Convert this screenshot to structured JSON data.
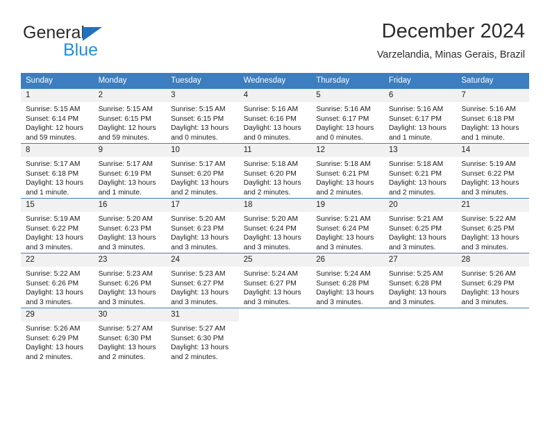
{
  "brand": {
    "name_part1": "General",
    "name_part2": "Blue",
    "flag_icon": "triangle-flag-icon"
  },
  "header": {
    "title": "December 2024",
    "subtitle": "Varzelandia, Minas Gerais, Brazil"
  },
  "colors": {
    "header_blue": "#3c7ebf",
    "brand_blue": "#1f8fdd",
    "flag_blue": "#1f72bc",
    "daynum_band": "#f1f1f1",
    "text": "#1c1c1c"
  },
  "calendar": {
    "weekday_headers": [
      "Sunday",
      "Monday",
      "Tuesday",
      "Wednesday",
      "Thursday",
      "Friday",
      "Saturday"
    ],
    "weeks": [
      [
        {
          "day": "1",
          "sunrise": "Sunrise: 5:15 AM",
          "sunset": "Sunset: 6:14 PM",
          "daylight_line1": "Daylight: 12 hours",
          "daylight_line2": "and 59 minutes."
        },
        {
          "day": "2",
          "sunrise": "Sunrise: 5:15 AM",
          "sunset": "Sunset: 6:15 PM",
          "daylight_line1": "Daylight: 12 hours",
          "daylight_line2": "and 59 minutes."
        },
        {
          "day": "3",
          "sunrise": "Sunrise: 5:15 AM",
          "sunset": "Sunset: 6:15 PM",
          "daylight_line1": "Daylight: 13 hours",
          "daylight_line2": "and 0 minutes."
        },
        {
          "day": "4",
          "sunrise": "Sunrise: 5:16 AM",
          "sunset": "Sunset: 6:16 PM",
          "daylight_line1": "Daylight: 13 hours",
          "daylight_line2": "and 0 minutes."
        },
        {
          "day": "5",
          "sunrise": "Sunrise: 5:16 AM",
          "sunset": "Sunset: 6:17 PM",
          "daylight_line1": "Daylight: 13 hours",
          "daylight_line2": "and 0 minutes."
        },
        {
          "day": "6",
          "sunrise": "Sunrise: 5:16 AM",
          "sunset": "Sunset: 6:17 PM",
          "daylight_line1": "Daylight: 13 hours",
          "daylight_line2": "and 1 minute."
        },
        {
          "day": "7",
          "sunrise": "Sunrise: 5:16 AM",
          "sunset": "Sunset: 6:18 PM",
          "daylight_line1": "Daylight: 13 hours",
          "daylight_line2": "and 1 minute."
        }
      ],
      [
        {
          "day": "8",
          "sunrise": "Sunrise: 5:17 AM",
          "sunset": "Sunset: 6:18 PM",
          "daylight_line1": "Daylight: 13 hours",
          "daylight_line2": "and 1 minute."
        },
        {
          "day": "9",
          "sunrise": "Sunrise: 5:17 AM",
          "sunset": "Sunset: 6:19 PM",
          "daylight_line1": "Daylight: 13 hours",
          "daylight_line2": "and 1 minute."
        },
        {
          "day": "10",
          "sunrise": "Sunrise: 5:17 AM",
          "sunset": "Sunset: 6:20 PM",
          "daylight_line1": "Daylight: 13 hours",
          "daylight_line2": "and 2 minutes."
        },
        {
          "day": "11",
          "sunrise": "Sunrise: 5:18 AM",
          "sunset": "Sunset: 6:20 PM",
          "daylight_line1": "Daylight: 13 hours",
          "daylight_line2": "and 2 minutes."
        },
        {
          "day": "12",
          "sunrise": "Sunrise: 5:18 AM",
          "sunset": "Sunset: 6:21 PM",
          "daylight_line1": "Daylight: 13 hours",
          "daylight_line2": "and 2 minutes."
        },
        {
          "day": "13",
          "sunrise": "Sunrise: 5:18 AM",
          "sunset": "Sunset: 6:21 PM",
          "daylight_line1": "Daylight: 13 hours",
          "daylight_line2": "and 2 minutes."
        },
        {
          "day": "14",
          "sunrise": "Sunrise: 5:19 AM",
          "sunset": "Sunset: 6:22 PM",
          "daylight_line1": "Daylight: 13 hours",
          "daylight_line2": "and 3 minutes."
        }
      ],
      [
        {
          "day": "15",
          "sunrise": "Sunrise: 5:19 AM",
          "sunset": "Sunset: 6:22 PM",
          "daylight_line1": "Daylight: 13 hours",
          "daylight_line2": "and 3 minutes."
        },
        {
          "day": "16",
          "sunrise": "Sunrise: 5:20 AM",
          "sunset": "Sunset: 6:23 PM",
          "daylight_line1": "Daylight: 13 hours",
          "daylight_line2": "and 3 minutes."
        },
        {
          "day": "17",
          "sunrise": "Sunrise: 5:20 AM",
          "sunset": "Sunset: 6:23 PM",
          "daylight_line1": "Daylight: 13 hours",
          "daylight_line2": "and 3 minutes."
        },
        {
          "day": "18",
          "sunrise": "Sunrise: 5:20 AM",
          "sunset": "Sunset: 6:24 PM",
          "daylight_line1": "Daylight: 13 hours",
          "daylight_line2": "and 3 minutes."
        },
        {
          "day": "19",
          "sunrise": "Sunrise: 5:21 AM",
          "sunset": "Sunset: 6:24 PM",
          "daylight_line1": "Daylight: 13 hours",
          "daylight_line2": "and 3 minutes."
        },
        {
          "day": "20",
          "sunrise": "Sunrise: 5:21 AM",
          "sunset": "Sunset: 6:25 PM",
          "daylight_line1": "Daylight: 13 hours",
          "daylight_line2": "and 3 minutes."
        },
        {
          "day": "21",
          "sunrise": "Sunrise: 5:22 AM",
          "sunset": "Sunset: 6:25 PM",
          "daylight_line1": "Daylight: 13 hours",
          "daylight_line2": "and 3 minutes."
        }
      ],
      [
        {
          "day": "22",
          "sunrise": "Sunrise: 5:22 AM",
          "sunset": "Sunset: 6:26 PM",
          "daylight_line1": "Daylight: 13 hours",
          "daylight_line2": "and 3 minutes."
        },
        {
          "day": "23",
          "sunrise": "Sunrise: 5:23 AM",
          "sunset": "Sunset: 6:26 PM",
          "daylight_line1": "Daylight: 13 hours",
          "daylight_line2": "and 3 minutes."
        },
        {
          "day": "24",
          "sunrise": "Sunrise: 5:23 AM",
          "sunset": "Sunset: 6:27 PM",
          "daylight_line1": "Daylight: 13 hours",
          "daylight_line2": "and 3 minutes."
        },
        {
          "day": "25",
          "sunrise": "Sunrise: 5:24 AM",
          "sunset": "Sunset: 6:27 PM",
          "daylight_line1": "Daylight: 13 hours",
          "daylight_line2": "and 3 minutes."
        },
        {
          "day": "26",
          "sunrise": "Sunrise: 5:24 AM",
          "sunset": "Sunset: 6:28 PM",
          "daylight_line1": "Daylight: 13 hours",
          "daylight_line2": "and 3 minutes."
        },
        {
          "day": "27",
          "sunrise": "Sunrise: 5:25 AM",
          "sunset": "Sunset: 6:28 PM",
          "daylight_line1": "Daylight: 13 hours",
          "daylight_line2": "and 3 minutes."
        },
        {
          "day": "28",
          "sunrise": "Sunrise: 5:26 AM",
          "sunset": "Sunset: 6:29 PM",
          "daylight_line1": "Daylight: 13 hours",
          "daylight_line2": "and 3 minutes."
        }
      ],
      [
        {
          "day": "29",
          "sunrise": "Sunrise: 5:26 AM",
          "sunset": "Sunset: 6:29 PM",
          "daylight_line1": "Daylight: 13 hours",
          "daylight_line2": "and 2 minutes."
        },
        {
          "day": "30",
          "sunrise": "Sunrise: 5:27 AM",
          "sunset": "Sunset: 6:30 PM",
          "daylight_line1": "Daylight: 13 hours",
          "daylight_line2": "and 2 minutes."
        },
        {
          "day": "31",
          "sunrise": "Sunrise: 5:27 AM",
          "sunset": "Sunset: 6:30 PM",
          "daylight_line1": "Daylight: 13 hours",
          "daylight_line2": "and 2 minutes."
        },
        {
          "day": "",
          "sunrise": "",
          "sunset": "",
          "daylight_line1": "",
          "daylight_line2": ""
        },
        {
          "day": "",
          "sunrise": "",
          "sunset": "",
          "daylight_line1": "",
          "daylight_line2": ""
        },
        {
          "day": "",
          "sunrise": "",
          "sunset": "",
          "daylight_line1": "",
          "daylight_line2": ""
        },
        {
          "day": "",
          "sunrise": "",
          "sunset": "",
          "daylight_line1": "",
          "daylight_line2": ""
        }
      ]
    ]
  }
}
